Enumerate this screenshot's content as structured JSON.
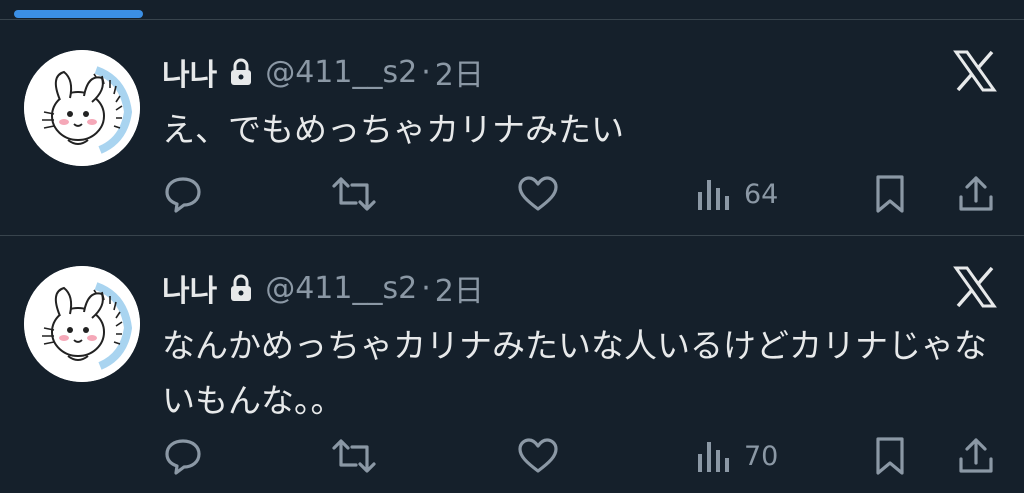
{
  "tweets": [
    {
      "display_name": "나나",
      "handle": "@411__s2",
      "separator": "·",
      "time": "2日",
      "text": "え、でもめっちゃカリナみたい",
      "views": "64"
    },
    {
      "display_name": "나나",
      "handle": "@411__s2",
      "separator": "·",
      "time": "2日",
      "text": "なんかめっちゃカリナみたいな人いるけどカリナじゃないもんな。。",
      "views": "70"
    }
  ],
  "icons": {
    "lock": "lock-icon",
    "brand": "x-logo-icon",
    "reply": "reply-icon",
    "retweet": "retweet-icon",
    "like": "heart-icon",
    "views": "views-icon",
    "bookmark": "bookmark-icon",
    "share": "share-icon"
  },
  "colors": {
    "background": "#15202b",
    "text": "#e7e9ea",
    "muted": "#8b98a5",
    "divider": "#38444d",
    "indicator": "#3b8fe5"
  }
}
